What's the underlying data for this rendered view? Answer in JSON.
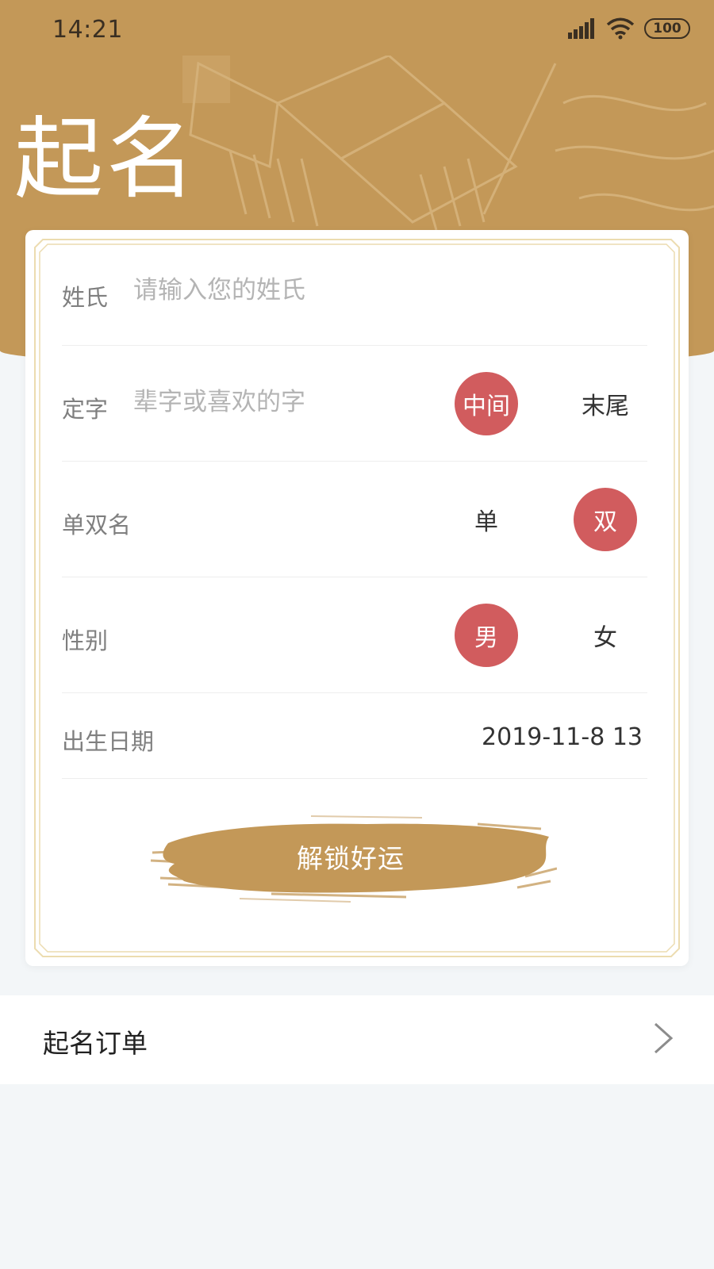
{
  "status_bar": {
    "time": "14:21",
    "battery": "100"
  },
  "header": {
    "title": "起名"
  },
  "form": {
    "surname": {
      "label": "姓氏",
      "placeholder": "请输入您的姓氏"
    },
    "fixed_char": {
      "label": "定字",
      "placeholder": "辈字或喜欢的字",
      "options": [
        "中间",
        "末尾"
      ],
      "selected": "中间"
    },
    "name_length": {
      "label": "单双名",
      "options": [
        "单",
        "双"
      ],
      "selected": "双"
    },
    "gender": {
      "label": "性别",
      "options": [
        "男",
        "女"
      ],
      "selected": "男"
    },
    "birth_date": {
      "label": "出生日期",
      "value": "2019-11-8 13"
    },
    "submit_label": "解锁好运"
  },
  "orders": {
    "label": "起名订单"
  },
  "colors": {
    "header": "#c39858",
    "selected": "#d15c5e",
    "brush": "#c39858",
    "background": "#f3f6f8"
  }
}
